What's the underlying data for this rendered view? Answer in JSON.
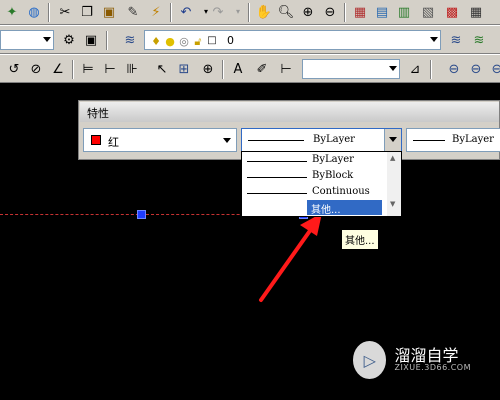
{
  "panel": {
    "title": "特性",
    "color_value": "红",
    "color_swatch": "#ff0000",
    "linetype_value": "ByLayer",
    "lineweight_value": "ByLayer"
  },
  "layer_combo": {
    "value": "0"
  },
  "dropdown": {
    "items": [
      "ByLayer",
      "ByBlock",
      "Continuous",
      "其他..."
    ],
    "selected_index": 3
  },
  "tooltip": {
    "text": "其他..."
  },
  "watermark": {
    "text": "溜溜自学",
    "sub": "ZIXUE.3D66.COM"
  },
  "colors": {
    "toolbar": "#d4d0c8",
    "canvas": "#000000",
    "highlight": "#316ac5",
    "arrow": "#ff1a1a",
    "grip": "#1f3cff"
  },
  "icons": {
    "toolbar1": [
      "publish-icon",
      "web-icon",
      "cut-icon",
      "copy-icon",
      "paste-icon",
      "match-properties-icon",
      "block-editor-icon",
      "undo-icon",
      "redo-icon",
      "pan-icon",
      "zoom-realtime-icon",
      "zoom-window-icon",
      "zoom-previous-icon",
      "properties-icon",
      "design-center-icon",
      "tool-palettes-icon",
      "sheet-set-icon",
      "markup-icon",
      "calculator-icon"
    ],
    "toolbar2": [
      "gear-icon",
      "layer-state-icon",
      "layer-manager-icon",
      "bulb-icon",
      "sun-icon",
      "lock-icon",
      "layer-prev-icon",
      "make-current-icon"
    ],
    "toolbar3": [
      "dim-linear-icon",
      "dim-radius-icon",
      "dim-angle-icon",
      "dim-baseline-icon",
      "dim-continue-icon",
      "tolerance-icon",
      "center-mark-icon",
      "text-style-icon",
      "dim-style-icon"
    ]
  }
}
